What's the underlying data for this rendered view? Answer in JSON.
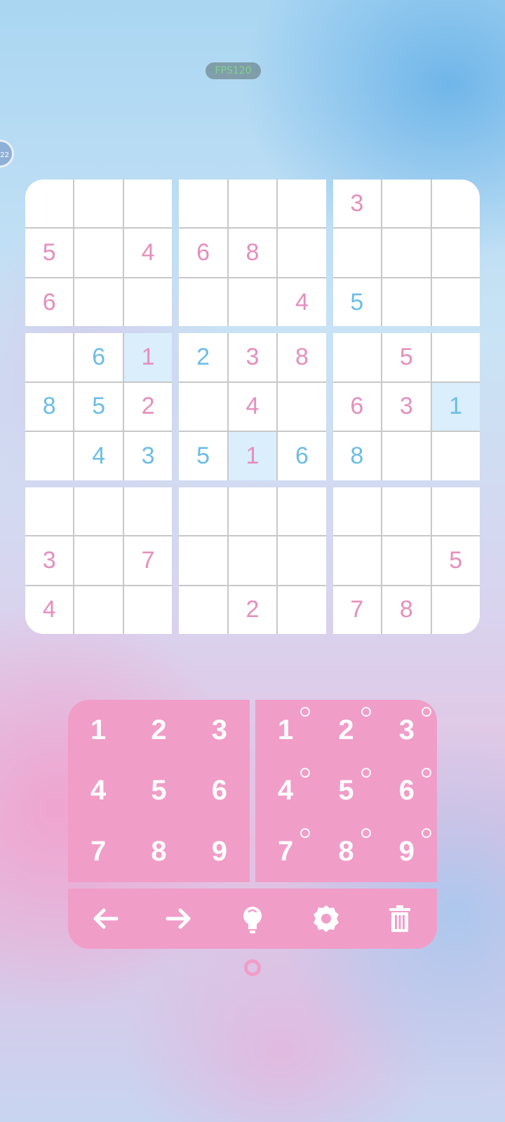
{
  "overlay": {
    "fps_label": "FPS120",
    "side_badge": "22"
  },
  "board": {
    "rows": [
      [
        "",
        "",
        "",
        "",
        "",
        "",
        "3",
        "",
        ""
      ],
      [
        "5",
        "",
        "4",
        "6",
        "8",
        "",
        "",
        "",
        ""
      ],
      [
        "6",
        "",
        "",
        "",
        "",
        "4",
        "5",
        "",
        ""
      ],
      [
        "",
        "6",
        "1",
        "2",
        "3",
        "8",
        "",
        "5",
        ""
      ],
      [
        "8",
        "5",
        "2",
        "",
        "4",
        "",
        "6",
        "3",
        "1"
      ],
      [
        "",
        "4",
        "3",
        "5",
        "1",
        "6",
        "8",
        "",
        ""
      ],
      [
        "",
        "",
        "",
        "",
        "",
        "",
        "",
        "",
        ""
      ],
      [
        "3",
        "",
        "7",
        "",
        "",
        "",
        "",
        "",
        "5"
      ],
      [
        "4",
        "",
        "",
        "",
        "2",
        "",
        "7",
        "8",
        ""
      ]
    ],
    "user_cells": [
      "2-6",
      "3-1",
      "3-3",
      "4-0",
      "4-1",
      "4-8",
      "5-1",
      "5-2",
      "5-3",
      "5-5",
      "5-6"
    ],
    "highlighted_cells": [
      "3-2",
      "4-8",
      "5-4"
    ],
    "colors": {
      "given": "#e58fbd",
      "user": "#6cbde6",
      "highlight": "#daeefb"
    }
  },
  "keypad": {
    "numbers": [
      "1",
      "2",
      "3",
      "4",
      "5",
      "6",
      "7",
      "8",
      "9"
    ],
    "notes": [
      "1",
      "2",
      "3",
      "4",
      "5",
      "6",
      "7",
      "8",
      "9"
    ],
    "accent": "#f09dc8"
  },
  "toolbar": {
    "tools": [
      "arrow-left-icon",
      "arrow-right-icon",
      "lightbulb-icon",
      "gear-icon",
      "trash-icon"
    ]
  }
}
